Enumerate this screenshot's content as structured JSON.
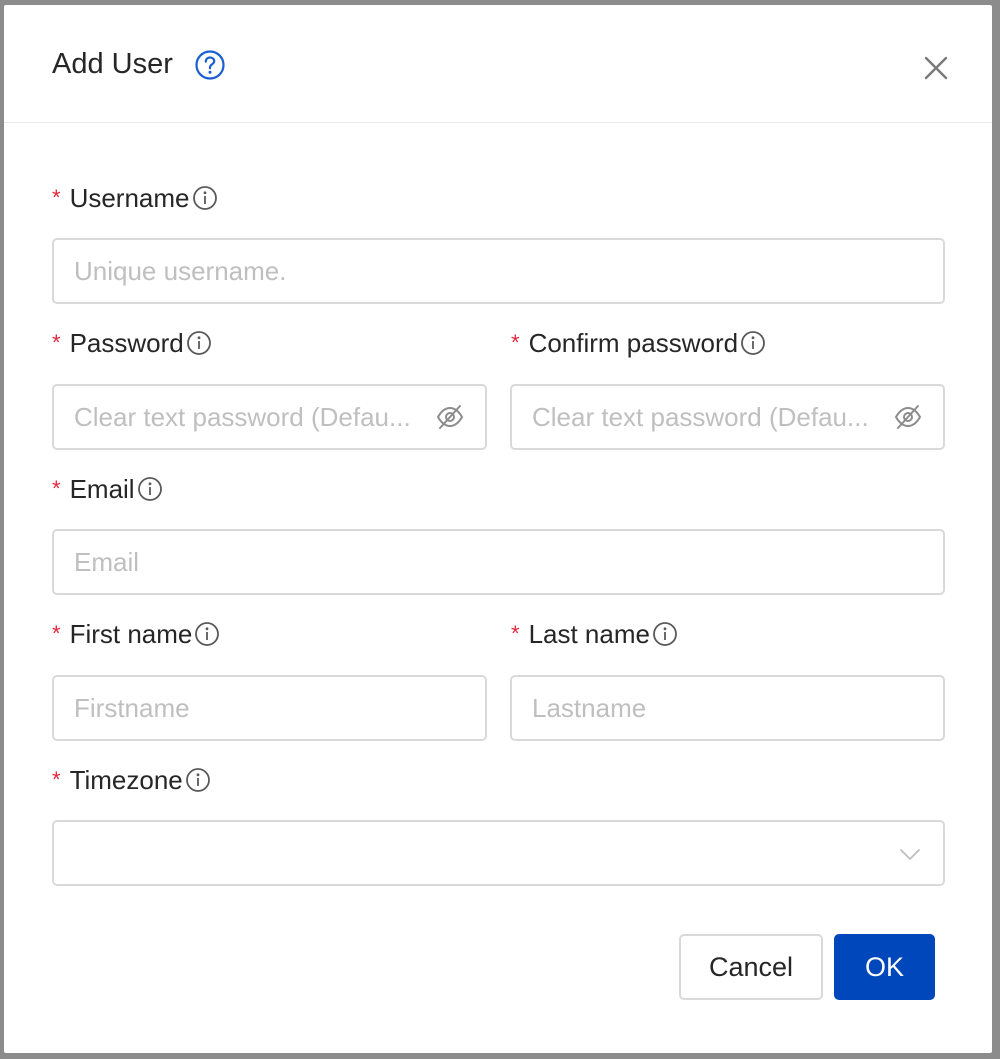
{
  "dialog": {
    "title": "Add User",
    "help_icon": "help-circle-icon",
    "close_icon": "close-icon"
  },
  "fields": {
    "username": {
      "label": "Username",
      "placeholder": "Unique username.",
      "required_mark": "*"
    },
    "password": {
      "label": "Password",
      "placeholder": "Clear text password (Defau...",
      "required_mark": "*"
    },
    "confirm_password": {
      "label": "Confirm password",
      "placeholder": "Clear text password (Defau...",
      "required_mark": "*"
    },
    "email": {
      "label": "Email",
      "placeholder": "Email",
      "required_mark": "*"
    },
    "first_name": {
      "label": "First name",
      "placeholder": "Firstname",
      "required_mark": "*"
    },
    "last_name": {
      "label": "Last name",
      "placeholder": "Lastname",
      "required_mark": "*"
    },
    "timezone": {
      "label": "Timezone",
      "value": "",
      "required_mark": "*"
    }
  },
  "buttons": {
    "cancel": "Cancel",
    "ok": "OK"
  },
  "colors": {
    "primary": "#0047bb",
    "required": "#e0283c",
    "help_icon": "#1a5fd1",
    "border": "#d9d9d9",
    "placeholder": "#bfbfbf"
  }
}
